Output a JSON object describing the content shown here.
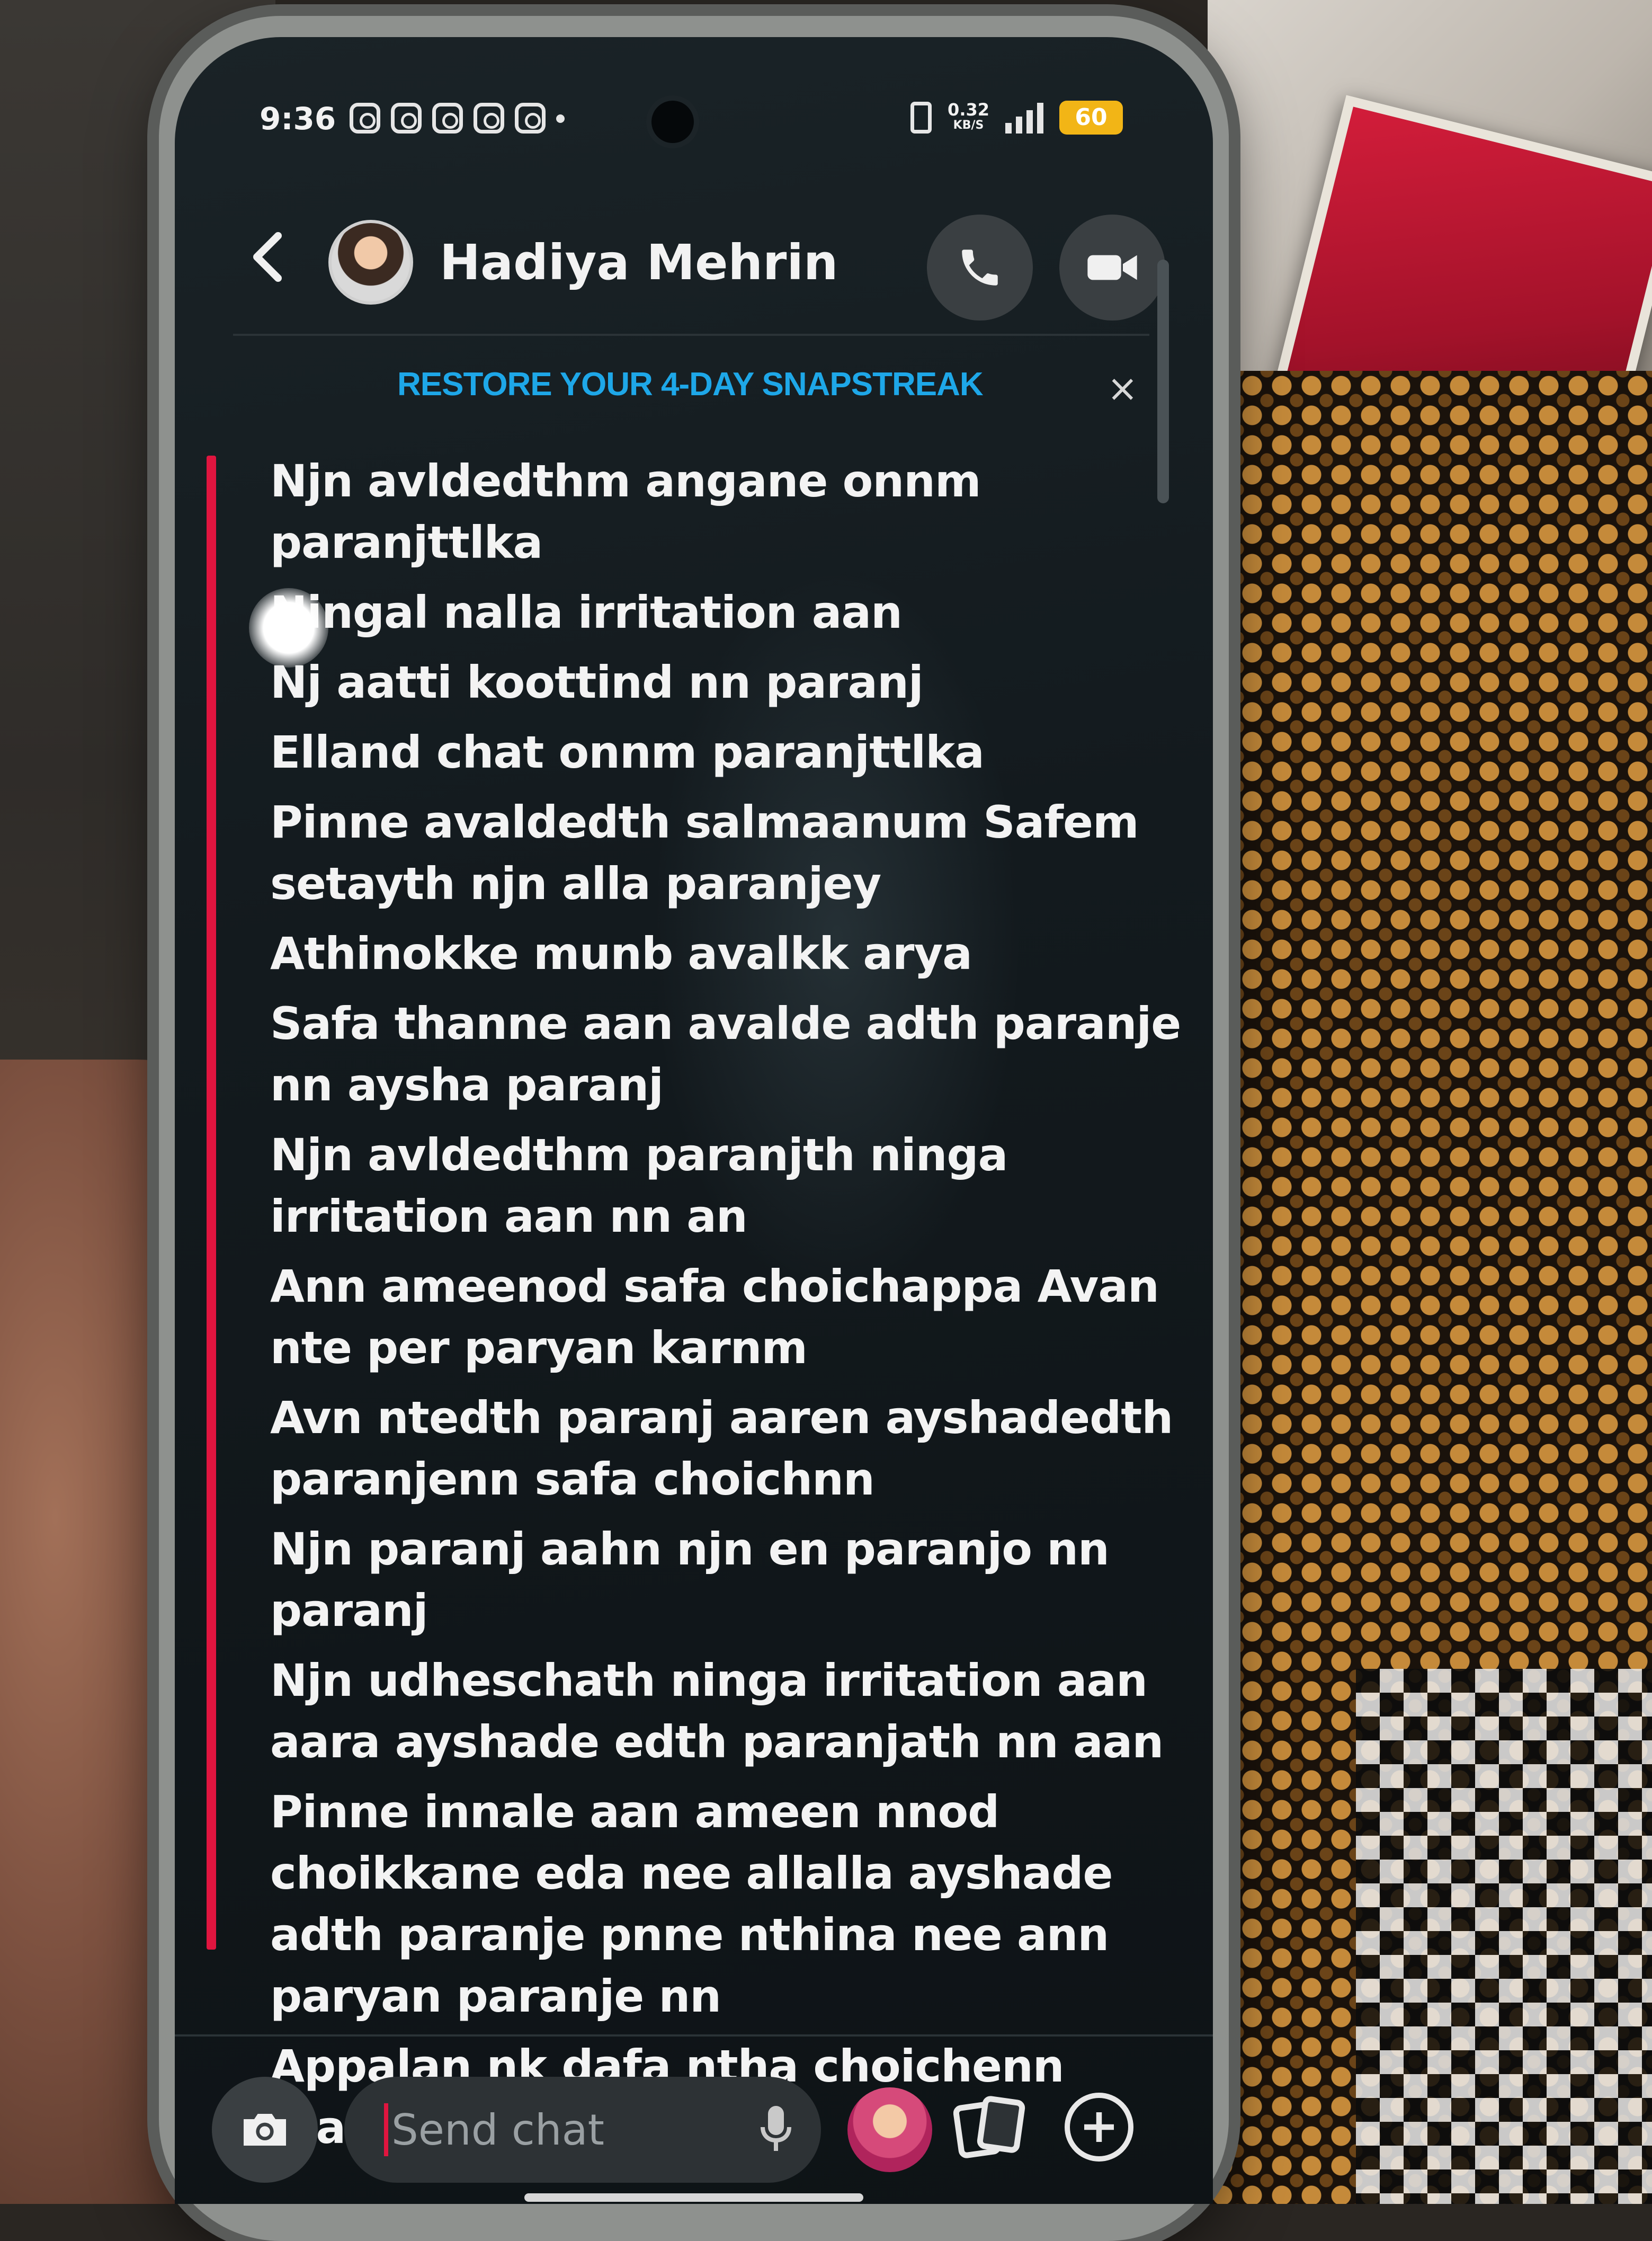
{
  "status_bar": {
    "time": "9:36",
    "net_speed": "0.32",
    "net_speed_unit": "KB/S",
    "battery": "60"
  },
  "header": {
    "contact_name": "Hadiya Mehrin"
  },
  "banner": {
    "text": "RESTORE YOUR 4-DAY SNAPSTREAK",
    "close": "×"
  },
  "messages": [
    "Njn avldedthm angane onnm paranjttlka",
    "Ningal nalla irritation aan",
    "Nj aatti koottind nn paranj",
    "Elland chat onnm paranjttlka",
    "Pinne avaldedth salmaanum Safem setayth njn alla paranjey",
    "Athinokke munb avalkk arya",
    "Safa thanne aan avalde adth paranje nn aysha paranj",
    "Njn avldedthm paranjth ninga irritation aan nn an",
    "Ann ameenod safa choichappa Avan nte per paryan karnm",
    "Avn ntedth paranj aaren ayshadedth paranjenn safa choichnn",
    "Njn paranj aahn njn en paranjo nn paranj",
    "Njn udheschath ninga irritation aan aara ayshade edth paranjath nn aan",
    "Pinne innale aan ameen nnod choikkane eda nee allalla ayshade adth paranje pnne nthina nee ann paryan paranje nn",
    "Appalan nk dafa ntha choichenn mansilavne"
  ],
  "composer": {
    "placeholder": "Send chat"
  },
  "icons": {
    "back": "back-arrow-icon",
    "call": "phone-icon",
    "video": "video-camera-icon",
    "camera": "camera-icon",
    "mic": "microphone-icon",
    "cards": "cards-icon",
    "plus": "plus-icon"
  },
  "colors": {
    "accent_streak": "#1ea7e8",
    "message_accent": "#e0153f",
    "battery": "#f2b516",
    "screen_bg": "#131a1e"
  }
}
